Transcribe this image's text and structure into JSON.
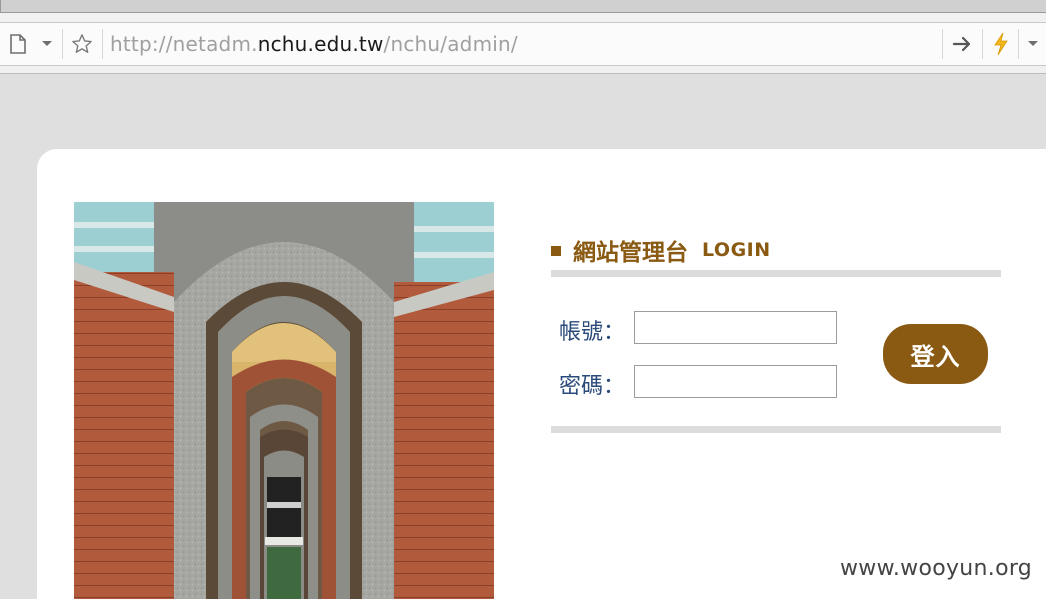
{
  "browser": {
    "url": {
      "prefix": "http://netadm.",
      "host": "nchu.edu.tw",
      "path": "/nchu/admin/"
    },
    "icons": {
      "page": "page-icon",
      "dropdown": "chevron-down-icon",
      "bookmark": "star-icon",
      "go": "arrow-right-icon",
      "bolt": "lightning-icon",
      "menu": "chevron-down-icon"
    }
  },
  "login": {
    "title_cn": "網站管理台",
    "title_en": "LOGIN",
    "account_label": "帳號：",
    "password_label": "密碼：",
    "account_value": "",
    "password_value": "",
    "submit_label": "登入"
  },
  "watermark": "www.wooyun.org",
  "colors": {
    "accent": "#8a5a12",
    "label": "#2a4a7a",
    "rule": "#dcdcdc",
    "background": "#dfdfdf"
  }
}
